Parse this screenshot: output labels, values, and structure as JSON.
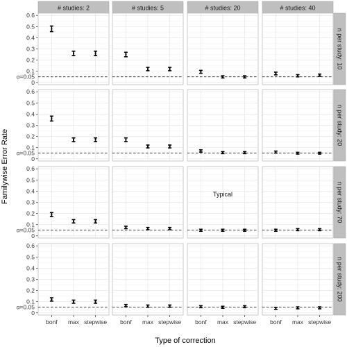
{
  "chart_data": {
    "type": "scatter",
    "subtype": "errorbar-facet-grid",
    "title": "",
    "xlabel": "Type of correction",
    "ylabel": "Familywise Error Rate",
    "categories": [
      "bonf",
      "max",
      "stepwise"
    ],
    "ylim": [
      -0.02,
      0.62
    ],
    "yticks": [
      0,
      0.1,
      0.2,
      0.3,
      0.4,
      0.5,
      0.6
    ],
    "ytick_labels": [
      "0",
      "0.1",
      "0.2",
      "0.3",
      "0.4",
      "0.5",
      "0.6"
    ],
    "reference_line": {
      "value": 0.05,
      "label": "α=0.05",
      "style": "dashed"
    },
    "grid": true,
    "col_facet_labels": [
      "# studies: 2",
      "# studies: 5",
      "# studies: 20",
      "# studies: 40"
    ],
    "row_facet_labels": [
      "n per study: 10",
      "n per study: 20",
      "n per study: 70",
      "n per study: 200"
    ],
    "annotation": {
      "text": "Typical",
      "row": 2,
      "col": 2
    },
    "panels": [
      [
        {
          "values": [
            0.48,
            0.26,
            0.26
          ],
          "err": [
            0.025,
            0.02,
            0.02
          ]
        },
        {
          "values": [
            0.25,
            0.12,
            0.12
          ],
          "err": [
            0.02,
            0.015,
            0.015
          ]
        },
        {
          "values": [
            0.095,
            0.05,
            0.05
          ],
          "err": [
            0.013,
            0.01,
            0.01
          ]
        },
        {
          "values": [
            0.08,
            0.06,
            0.065
          ],
          "err": [
            0.012,
            0.01,
            0.01
          ]
        }
      ],
      [
        {
          "values": [
            0.36,
            0.17,
            0.17
          ],
          "err": [
            0.022,
            0.017,
            0.017
          ]
        },
        {
          "values": [
            0.17,
            0.11,
            0.11
          ],
          "err": [
            0.017,
            0.013,
            0.013
          ]
        },
        {
          "values": [
            0.07,
            0.055,
            0.055
          ],
          "err": [
            0.01,
            0.009,
            0.009
          ]
        },
        {
          "values": [
            0.06,
            0.05,
            0.05
          ],
          "err": [
            0.009,
            0.008,
            0.008
          ]
        }
      ],
      [
        {
          "values": [
            0.19,
            0.13,
            0.13
          ],
          "err": [
            0.018,
            0.015,
            0.015
          ]
        },
        {
          "values": [
            0.075,
            0.065,
            0.065
          ],
          "err": [
            0.011,
            0.01,
            0.01
          ]
        },
        {
          "values": [
            0.05,
            0.05,
            0.05
          ],
          "err": [
            0.009,
            0.009,
            0.009
          ]
        },
        {
          "values": [
            0.05,
            0.055,
            0.055
          ],
          "err": [
            0.009,
            0.009,
            0.009
          ]
        }
      ],
      [
        {
          "values": [
            0.12,
            0.1,
            0.1
          ],
          "err": [
            0.015,
            0.014,
            0.014
          ]
        },
        {
          "values": [
            0.065,
            0.06,
            0.06
          ],
          "err": [
            0.01,
            0.01,
            0.01
          ]
        },
        {
          "values": [
            0.055,
            0.05,
            0.055
          ],
          "err": [
            0.009,
            0.009,
            0.009
          ]
        },
        {
          "values": [
            0.04,
            0.045,
            0.045
          ],
          "err": [
            0.009,
            0.009,
            0.009
          ]
        }
      ]
    ]
  }
}
